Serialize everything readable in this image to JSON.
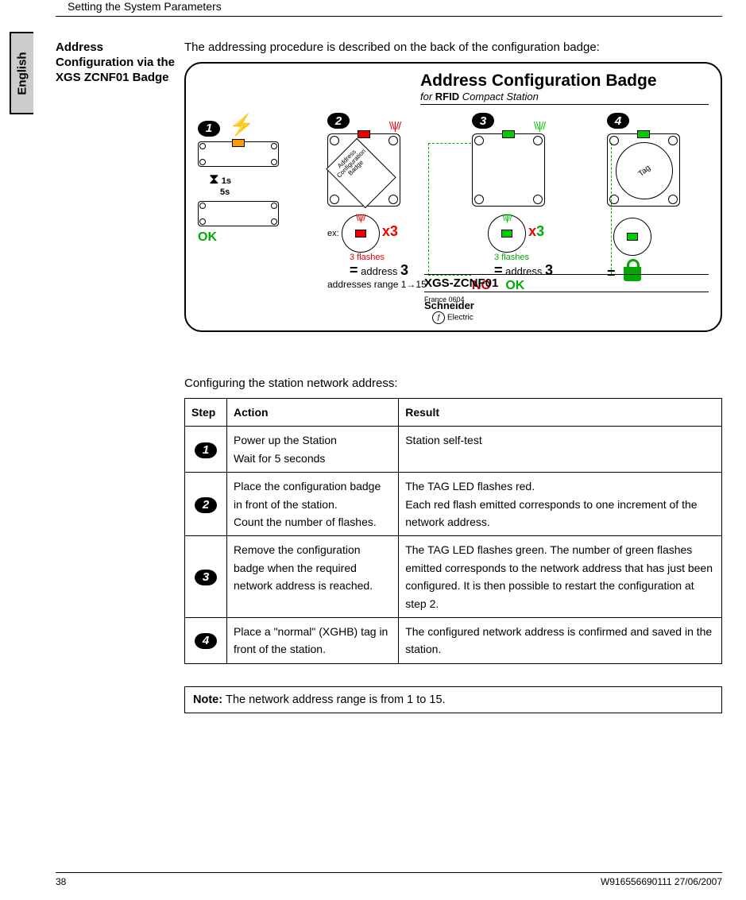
{
  "header": {
    "chapter": "Setting the System Parameters",
    "language_tab": "English"
  },
  "section": {
    "side_heading": "Address Configuration via the XGS ZCNF01 Badge",
    "intro": "The addressing procedure is described on the back of the configuration badge:"
  },
  "badge": {
    "title": "Address Configuration Badge",
    "subtitle_prefix": "for ",
    "subtitle_bold": "RFID",
    "subtitle_suffix": " Compact Station",
    "model": "XGS-ZCNF01",
    "origin": "France 0604",
    "brand": "Schneider",
    "brand_sub": "Electric",
    "step1": {
      "num": "1",
      "time1": "1s",
      "time2": "5s",
      "ok": "OK"
    },
    "step2": {
      "num": "2",
      "card_text": "Address Configuration Badge",
      "ex": "ex:",
      "x": "x",
      "three": "3",
      "flashes": "3 flashes",
      "eq": "=",
      "addr_label": "address ",
      "addr_val": "3",
      "range": "addresses range 1→15"
    },
    "step3": {
      "num": "3",
      "x": "x",
      "three": "3",
      "flashes": "3 flashes",
      "eq": "=",
      "addr_label": "address ",
      "addr_val": "3",
      "no": "NO",
      "ok": "OK"
    },
    "step4": {
      "num": "4",
      "tag": "Tag",
      "eq": "="
    }
  },
  "table": {
    "title": "Configuring the station network address:",
    "headers": {
      "step": "Step",
      "action": "Action",
      "result": "Result"
    },
    "rows": [
      {
        "num": "1",
        "action": "Power up the Station\nWait for 5 seconds",
        "result": "Station self-test"
      },
      {
        "num": "2",
        "action": "Place the configuration badge in front of the station.\nCount the number of flashes.",
        "result": "The TAG LED flashes red.\nEach red flash emitted corresponds to one increment of the network address."
      },
      {
        "num": "3",
        "action": "Remove the configuration badge when the required network address is reached.",
        "result": "The TAG LED flashes green. The number of green flashes emitted corresponds to the network address that has just been configured. It is then possible to restart the configuration at step 2."
      },
      {
        "num": "4",
        "action": "Place a \"normal\" (XGHB) tag in front of the station.",
        "result": "The configured network address is confirmed and saved in the station."
      }
    ]
  },
  "note": {
    "label": "Note: ",
    "text": "The network address range is from 1 to 15."
  },
  "footer": {
    "page": "38",
    "docref": "W916556690111 27/06/2007"
  }
}
